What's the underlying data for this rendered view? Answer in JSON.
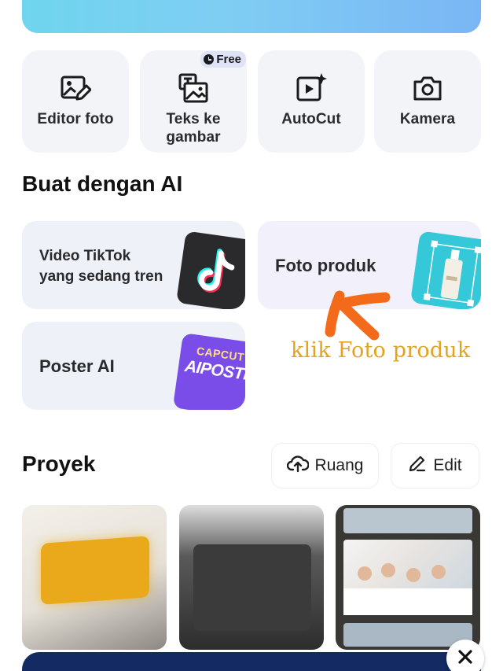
{
  "tools": [
    {
      "label": "Editor foto",
      "icon": "photo-edit-icon"
    },
    {
      "label": "Teks ke gambar",
      "icon": "text-to-image-icon",
      "badge": "Free"
    },
    {
      "label": "AutoCut",
      "icon": "autocut-icon"
    },
    {
      "label": "Kamera",
      "icon": "camera-icon"
    }
  ],
  "ai_section": {
    "title": "Buat dengan AI",
    "cards": [
      {
        "label_line1": "Video TikTok",
        "label_line2": "yang sedang tren"
      },
      {
        "label": "Foto produk"
      },
      {
        "label": "Poster AI",
        "art_top": "CAPCUT",
        "art_main": "AIPOSTER"
      }
    ]
  },
  "annotation": {
    "text": "klik Foto produk",
    "color": "#e3a322",
    "arrow_color": "#f36a1a"
  },
  "projects": {
    "title": "Proyek",
    "storage_label": "Ruang",
    "edit_label": "Edit",
    "thumbnails": [
      {
        "name": "project-thumbnail-1"
      },
      {
        "name": "project-thumbnail-2"
      },
      {
        "name": "project-thumbnail-3"
      }
    ]
  },
  "colors": {
    "card_bg": "#f2f4f7",
    "banner_top": "#7ec8f2",
    "banner_bottom": "#142a62"
  }
}
